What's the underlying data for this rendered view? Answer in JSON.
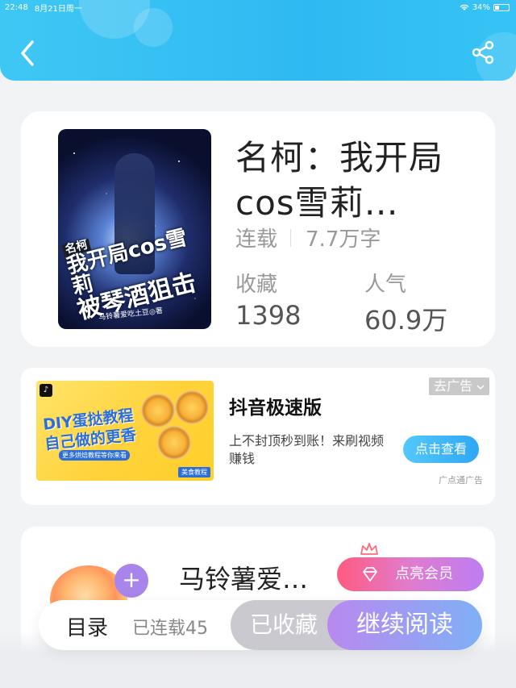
{
  "status_bar": {
    "time": "22:48",
    "date": "8月21日周一",
    "battery": "34%"
  },
  "header": {
    "back_icon": "chevron-left-icon",
    "share_icon": "share-icon"
  },
  "book": {
    "title": "名柯：我开局cos雪莉…",
    "status": "连载",
    "word_count": "7.7万字",
    "favorites_label": "收藏",
    "favorites_value": "1398",
    "popularity_label": "人气",
    "popularity_value": "60.9万",
    "cover": {
      "tag": "名柯",
      "line1": "我开局cos雪莉",
      "line2": "被琴酒狙击",
      "author": "马铃薯爱吃土豆◎著"
    }
  },
  "ad": {
    "image_tag": "美食教程",
    "image_line1": "DIY蛋挞教程",
    "image_line2": "自己做的更香",
    "image_sub": "更多烘焙教程等你来看",
    "title": "抖音极速版",
    "description": "上不封顶秒到账！来刷视频赚钱",
    "button": "点击查看",
    "close_label": "去广告",
    "source": "广点通广告"
  },
  "author": {
    "name": "马铃薯爱…",
    "plus": "+",
    "vip_button": "点亮会员"
  },
  "bottom_bar": {
    "toc": "目录",
    "serial": "已连载45",
    "collected": "已收藏",
    "read": "继续阅读"
  },
  "colors": {
    "header": "#2fb9f2",
    "accent_blue": "#2ea7f5",
    "vip_pink": "#ff5b80",
    "read_purple": "#b989f0"
  }
}
